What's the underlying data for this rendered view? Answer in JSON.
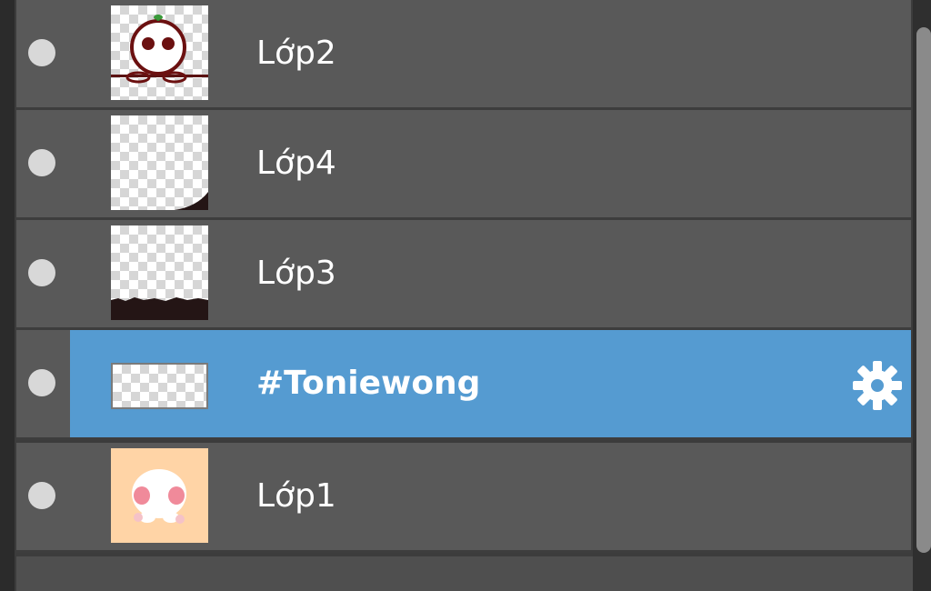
{
  "layers_panel": {
    "layers": [
      {
        "name": "Lớp2",
        "visible": true,
        "selected": false,
        "thumbnail": "cherry-character-thumb"
      },
      {
        "name": "Lớp4",
        "visible": true,
        "selected": false,
        "thumbnail": "corner-shape-thumb"
      },
      {
        "name": "Lớp3",
        "visible": true,
        "selected": false,
        "thumbnail": "ground-strip-thumb"
      },
      {
        "name": "#Toniewong",
        "visible": true,
        "selected": true,
        "thumbnail": "text-layer-thumb",
        "settings_icon": "gear-icon"
      },
      {
        "name": "Lớp1",
        "visible": true,
        "selected": false,
        "thumbnail": "pink-character-thumb"
      }
    ],
    "colors": {
      "row_background": "#595959",
      "selected_background": "#559bd1",
      "text": "#ffffff",
      "peach_thumb": "#ffd4a6"
    }
  }
}
